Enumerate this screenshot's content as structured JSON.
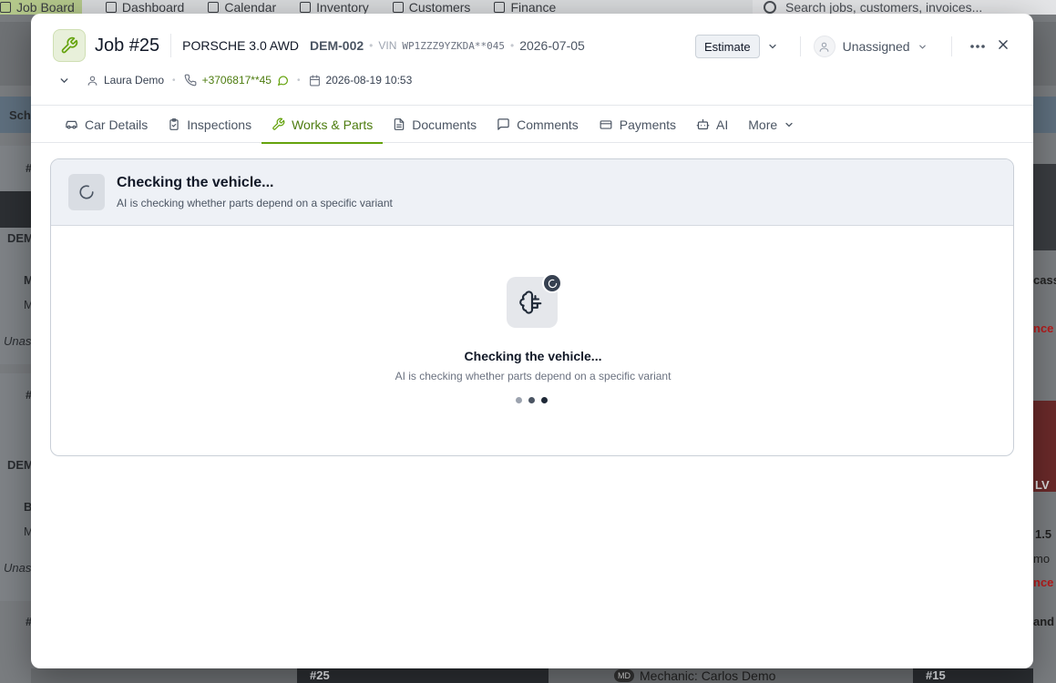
{
  "background": {
    "nav": [
      {
        "label": "Job Board",
        "icon": "grid-icon",
        "active": true
      },
      {
        "label": "Dashboard",
        "icon": "chart-icon"
      },
      {
        "label": "Calendar",
        "icon": "calendar-icon"
      },
      {
        "label": "Inventory",
        "icon": "box-icon"
      },
      {
        "label": "Customers",
        "icon": "users-icon"
      },
      {
        "label": "Finance",
        "icon": "dollar-icon"
      }
    ],
    "search_placeholder": "Search jobs, customers, invoices...",
    "left_labels": [
      "Sche",
      "#",
      "DEM",
      "M",
      "M",
      "Unas",
      "#",
      "DEM",
      "B",
      "M",
      "Unas",
      "#"
    ],
    "right_labels": [
      "cass",
      "nce",
      "1.5",
      "mo",
      "nce",
      "and",
      "LV"
    ],
    "bottom_cards": [
      "#25",
      "#15"
    ],
    "bottom_mechanic": "Mechanic: Carlos Demo",
    "bottom_mechanic_initials": "MD"
  },
  "job": {
    "title": "Job #25",
    "car_name": "PORSCHE 3.0 AWD",
    "car_code": "DEM-002",
    "vin_label": "VIN",
    "vin": "WP1ZZZ9YZKDA**045",
    "date": "2026-07-05",
    "customer": "Laura Demo",
    "phone": "+3706817**45",
    "appointment": "2026-08-19 10:53",
    "status": "Estimate",
    "assignee": "Unassigned"
  },
  "tabs": [
    {
      "label": "Car Details",
      "icon": "car-icon"
    },
    {
      "label": "Inspections",
      "icon": "clipboard-icon"
    },
    {
      "label": "Works & Parts",
      "icon": "wrench-icon",
      "active": true
    },
    {
      "label": "Documents",
      "icon": "document-icon"
    },
    {
      "label": "Comments",
      "icon": "comment-icon"
    },
    {
      "label": "Payments",
      "icon": "card-icon"
    },
    {
      "label": "AI",
      "icon": "robot-icon"
    },
    {
      "label": "More",
      "icon": "chevron-down-icon"
    }
  ],
  "ai_check": {
    "title": "Checking the vehicle...",
    "subtitle": "AI is checking whether parts depend on a specific variant"
  },
  "colors": {
    "accent": "#65a30d",
    "accent_text": "#4d7c0f",
    "panel_header": "#eef1f6"
  }
}
